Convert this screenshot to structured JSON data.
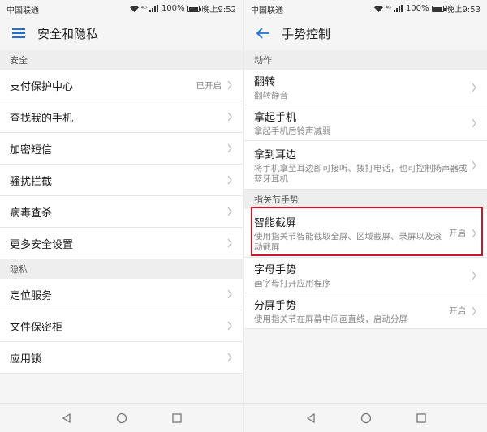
{
  "left": {
    "status": {
      "carrier": "中国联通",
      "signal_tag": "⁴ᴳ",
      "battery": "100%",
      "time": "晚上9:52"
    },
    "title": "安全和隐私",
    "sections": [
      {
        "header": "安全",
        "items": [
          {
            "label": "支付保护中心",
            "value": "已开启"
          },
          {
            "label": "查找我的手机",
            "value": ""
          },
          {
            "label": "加密短信",
            "value": ""
          },
          {
            "label": "骚扰拦截",
            "value": ""
          },
          {
            "label": "病毒查杀",
            "value": ""
          },
          {
            "label": "更多安全设置",
            "value": ""
          }
        ]
      },
      {
        "header": "隐私",
        "items": [
          {
            "label": "定位服务",
            "value": ""
          },
          {
            "label": "文件保密柜",
            "value": ""
          },
          {
            "label": "应用锁",
            "value": ""
          }
        ]
      }
    ]
  },
  "right": {
    "status": {
      "carrier": "中国联通",
      "signal_tag": "⁴ᴳ",
      "battery": "100%",
      "time": "晚上9:53"
    },
    "title": "手势控制",
    "sections": [
      {
        "header": "动作",
        "items": [
          {
            "label": "翻转",
            "sub": "翻转静音",
            "value": ""
          },
          {
            "label": "拿起手机",
            "sub": "拿起手机后铃声减弱",
            "value": ""
          },
          {
            "label": "拿到耳边",
            "sub": "将手机拿至耳边即可接听、拨打电话，也可控制扬声器或蓝牙耳机",
            "value": ""
          }
        ]
      },
      {
        "header": "指关节手势",
        "items": [
          {
            "label": "智能截屏",
            "sub": "使用指关节智能截取全屏、区域截屏、录屏以及滚动截屏",
            "value": "开启",
            "highlighted": true
          },
          {
            "label": "字母手势",
            "sub": "画字母打开应用程序",
            "value": ""
          },
          {
            "label": "分屏手势",
            "sub": "使用指关节在屏幕中间画直线，启动分屏",
            "value": "开启"
          }
        ]
      }
    ]
  },
  "colors": {
    "highlight": "#d0142c",
    "accent": "#1e6fd9"
  },
  "icons": [
    "menu-icon",
    "back-arrow-icon",
    "chevron-right-icon",
    "nav-back-icon",
    "nav-home-icon",
    "nav-recents-icon"
  ]
}
